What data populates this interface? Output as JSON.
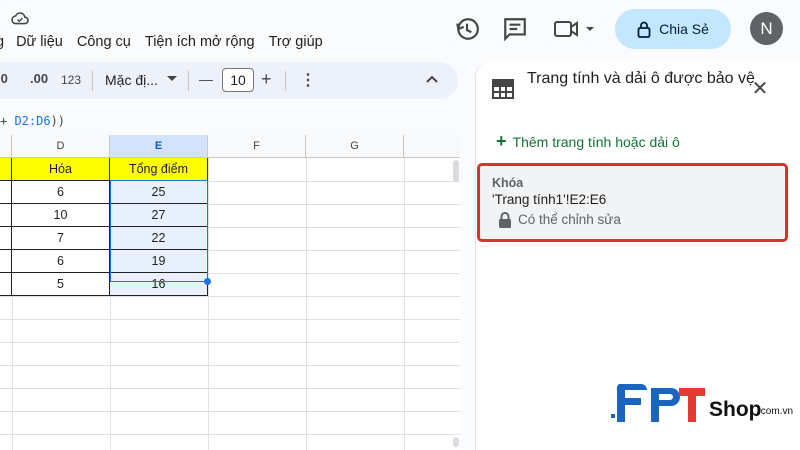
{
  "menu": [
    "g",
    "Dữ liệu",
    "Công cụ",
    "Tiện ích mở rộng",
    "Trợ giúp"
  ],
  "header_actions": {
    "history_icon": "history-icon",
    "comment_icon": "comment-icon",
    "meet_icon": "video-camera-icon",
    "share_label": "Chia Sẻ",
    "avatar_letter": "N"
  },
  "toolbar": {
    "decrease_decimal": ".0",
    "increase_decimal": ".00",
    "number_format": "123",
    "font_name": "Mặc đị...",
    "font_size": "10",
    "minus": "—",
    "plus": "+",
    "more": "⋮",
    "collapse": "^"
  },
  "formula": {
    "prefix": "+ ",
    "range": "D2:D6",
    "suffix": "))"
  },
  "grid": {
    "columns": [
      "D",
      "E",
      "F",
      "G"
    ],
    "selected_column": "E",
    "header_row": [
      "Hóa",
      "Tổng điểm"
    ],
    "rows": [
      [
        "6",
        "25"
      ],
      [
        "10",
        "27"
      ],
      [
        "7",
        "22"
      ],
      [
        "6",
        "19"
      ],
      [
        "5",
        "16"
      ]
    ]
  },
  "panel": {
    "title": "Trang tính và dải ô được bảo vệ",
    "add_label": "Thêm trang tính hoặc dải ô",
    "item": {
      "name": "Khóa",
      "range": "'Trang tính1'!E2:E6",
      "permission": "Có thể chỉnh sửa"
    }
  },
  "watermark": {
    "brand": "FPT",
    "shop": "Shop",
    "domain": ".com.vn"
  },
  "colors": {
    "accent": "#1a73e8",
    "share_bg": "#c2e7ff",
    "highlight_yellow": "#ffff00",
    "card_border": "#d7322f",
    "add_green": "#137333"
  }
}
